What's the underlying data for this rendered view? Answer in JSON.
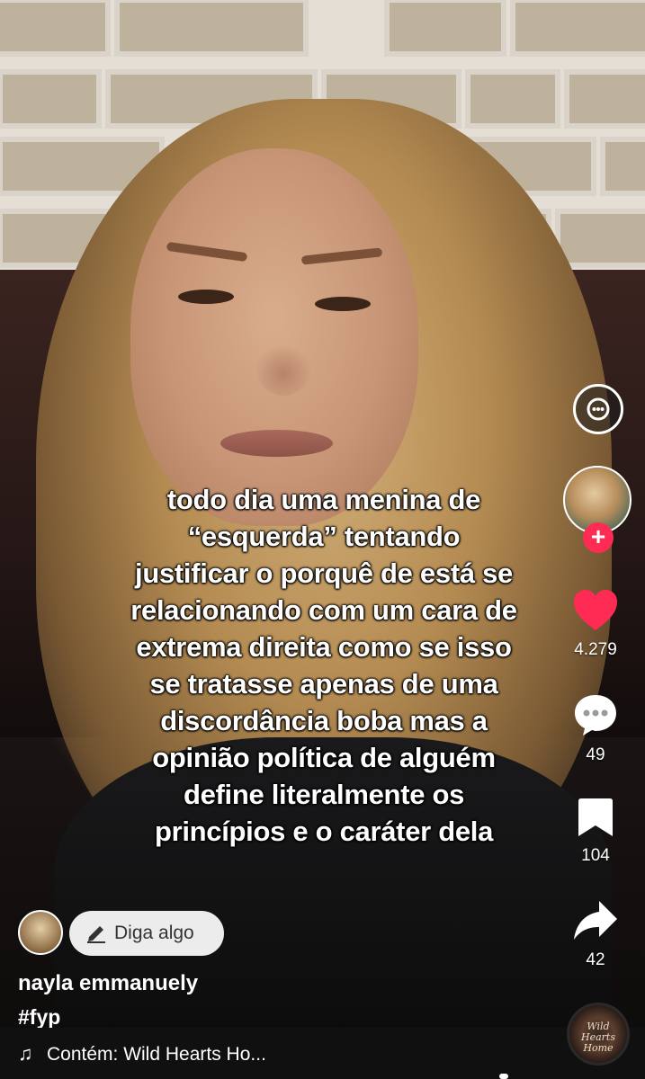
{
  "caption": {
    "lines": [
      "todo dia uma menina de",
      "“esquerda” tentando",
      "justificar o porquê de está se",
      "relacionando com um cara de",
      "extrema direita como se isso",
      "se tratasse apenas de uma",
      "discordância boba mas a",
      "opinião política de alguém",
      "define literalmente os",
      "princípios e o caráter dela"
    ]
  },
  "actions": {
    "likes": "4.279",
    "comments": "49",
    "saves": "104",
    "shares": "42"
  },
  "author": {
    "username": "nayla emmanuely",
    "hashtag": "#fyp"
  },
  "comment_input": {
    "placeholder": "Diga algo"
  },
  "music": {
    "text": "Contém: Wild Hearts Ho...",
    "disc_label_line1": "Wild",
    "disc_label_line2": "Hearts",
    "disc_label_line3": "Home"
  },
  "colors": {
    "like": "#fe2c55",
    "follow": "#fe2c55"
  },
  "icons": [
    "captions-icon",
    "follow-plus-icon",
    "heart-icon",
    "comment-icon",
    "bookmark-icon",
    "share-icon",
    "pencil-icon",
    "music-note-icon"
  ]
}
